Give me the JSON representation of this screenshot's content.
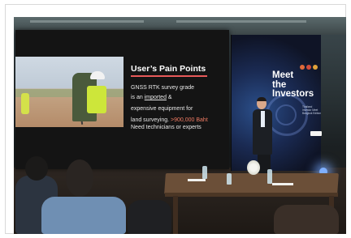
{
  "slide": {
    "title": "User’s Pain Points",
    "line1": "GNSS RTK survey grade",
    "line2_prefix": "is an ",
    "line2_link": "imported",
    "line2_suffix": " &",
    "line3": "expensive equipment for",
    "line4_prefix": "land surveying. ",
    "line4_accent": ">900,000 Baht",
    "line5": "Need technicians or experts"
  },
  "event_screen": {
    "title": "Meet\nthe\nInvestors",
    "subtitle": "Thailand\nInvestor Meet\nBangkok Edition"
  },
  "colors": {
    "accent": "#f07b63",
    "underline": "#e85a5a",
    "event_blue": "#2b4f8a"
  }
}
